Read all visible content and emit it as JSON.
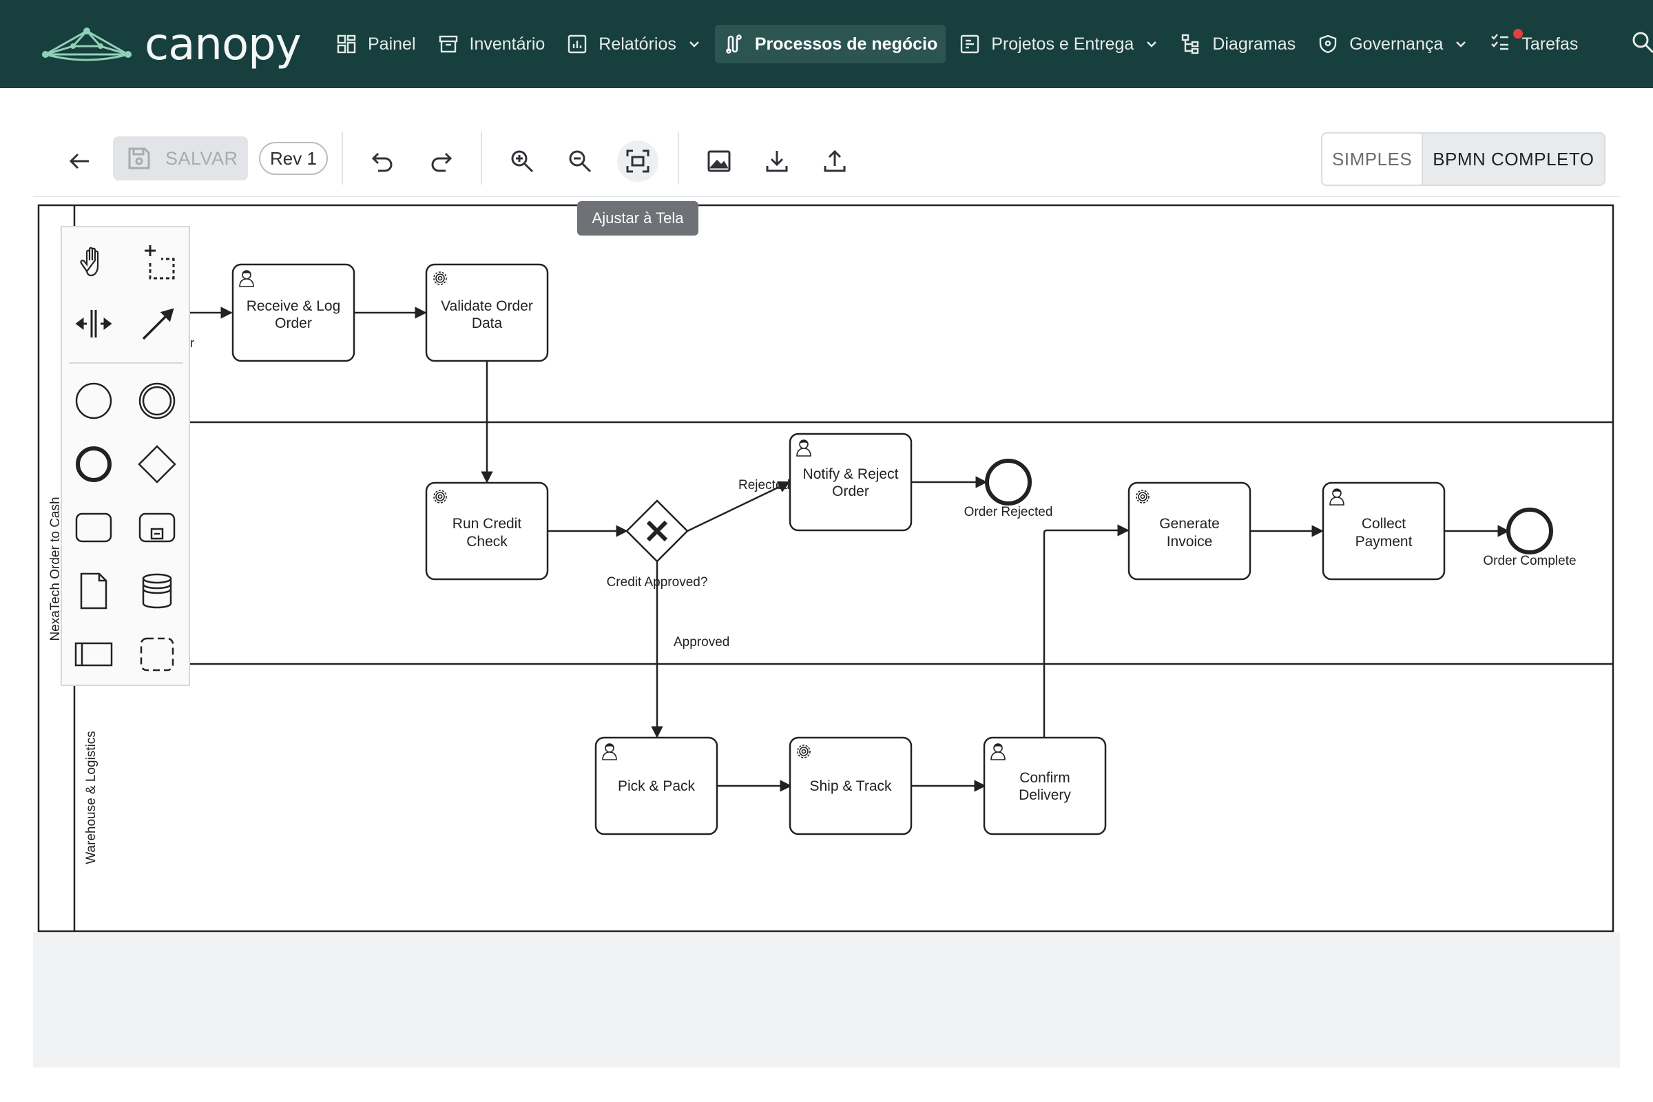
{
  "app": {
    "brand": "canopy"
  },
  "nav": {
    "items": [
      {
        "label": "Painel",
        "icon": "dashboard-icon"
      },
      {
        "label": "Inventário",
        "icon": "archive-icon"
      },
      {
        "label": "Relatórios",
        "icon": "bar-chart-icon",
        "dropdown": true
      },
      {
        "label": "Processos de negócio",
        "icon": "workflow-icon",
        "active": true
      },
      {
        "label": "Projetos e Entrega",
        "icon": "kanban-icon",
        "dropdown": true
      },
      {
        "label": "Diagramas",
        "icon": "hierarchy-icon"
      },
      {
        "label": "Governança",
        "icon": "shield-icon",
        "dropdown": true
      },
      {
        "label": "Tarefas",
        "icon": "checklist-icon",
        "notification": true
      }
    ]
  },
  "toolbar": {
    "save_label": "SALVAR",
    "revision": "Rev 1",
    "tooltip": "Ajustar à Tela",
    "mode_simple": "SIMPLES",
    "mode_full": "BPMN COMPLETO"
  },
  "diagram": {
    "pool_name": "NexaTech Order to Cash",
    "lane_bottom": "Warehouse & Logistics",
    "lane_top_partial_label": "r",
    "tasks": {
      "receive": [
        "Receive & Log",
        "Order"
      ],
      "validate": [
        "Validate Order",
        "Data"
      ],
      "credit": [
        "Run Credit",
        "Check"
      ],
      "notify": [
        "Notify & Reject",
        "Order"
      ],
      "invoice": [
        "Generate",
        "Invoice"
      ],
      "payment": [
        "Collect",
        "Payment"
      ],
      "pick": [
        "Pick & Pack"
      ],
      "ship": [
        "Ship & Track"
      ],
      "confirm": [
        "Confirm",
        "Delivery"
      ]
    },
    "gateway_label": "Credit Approved?",
    "flow_rejected": "Rejected",
    "flow_approved": "Approved",
    "end_rejected": "Order Rejected",
    "end_complete": "Order Complete"
  },
  "colors": {
    "nav_bg": "#173f3d",
    "nav_active": "#2c5552",
    "accent_logo": "#8fd1b8",
    "notification": "#e5403a"
  }
}
